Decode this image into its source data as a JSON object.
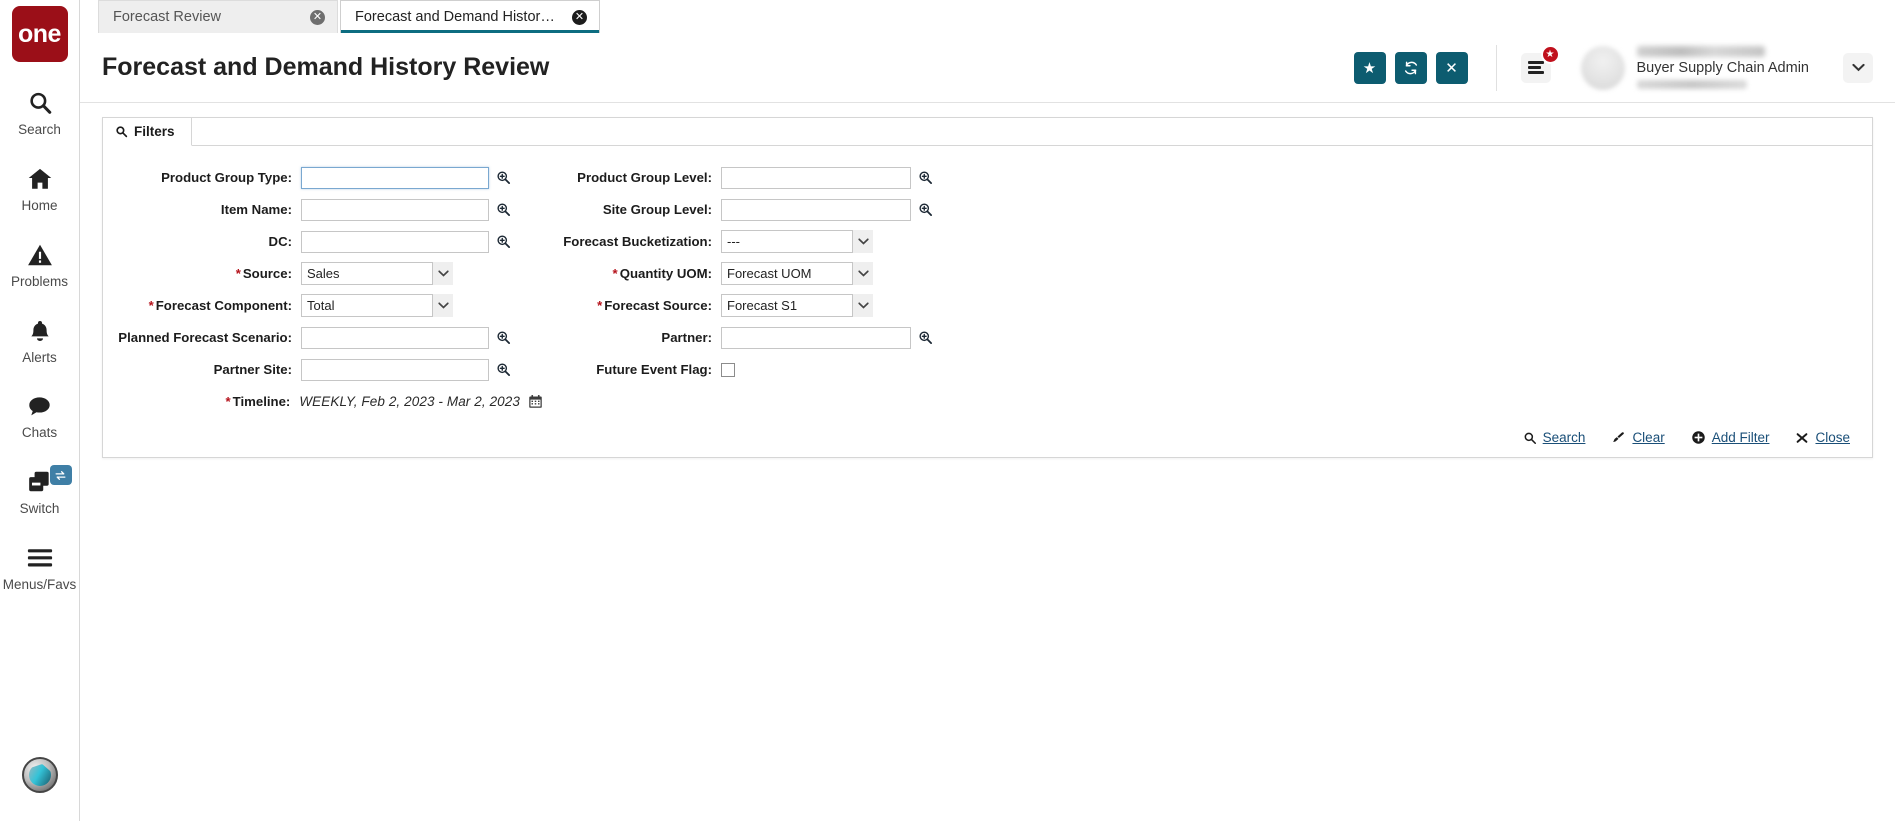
{
  "brand": {
    "logo_text": "one"
  },
  "sidebar": {
    "items": [
      {
        "label": "Search",
        "icon": "search-icon"
      },
      {
        "label": "Home",
        "icon": "home-icon"
      },
      {
        "label": "Problems",
        "icon": "warning-triangle-icon"
      },
      {
        "label": "Alerts",
        "icon": "bell-icon"
      },
      {
        "label": "Chats",
        "icon": "chat-bubble-icon"
      },
      {
        "label": "Switch",
        "icon": "switch-windows-icon",
        "badge_icon": "transfer-arrows-icon"
      },
      {
        "label": "Menus/Favs",
        "icon": "hamburger-icon"
      }
    ],
    "assistant_icon": "assistant-avatar-icon"
  },
  "tabs": [
    {
      "label": "Forecast Review",
      "active": false,
      "close_label": "✕"
    },
    {
      "label": "Forecast and Demand History Re...",
      "active": true,
      "close_label": "✕"
    }
  ],
  "header": {
    "title": "Forecast and Demand History Review",
    "actions": [
      {
        "name": "favorite-button",
        "icon": "star-icon",
        "glyph": "★"
      },
      {
        "name": "refresh-button",
        "icon": "refresh-icon",
        "glyph": "↻"
      },
      {
        "name": "close-button",
        "icon": "close-icon",
        "glyph": "✕"
      }
    ],
    "menu_badge_glyph": "★",
    "user_role": "Buyer Supply Chain Admin",
    "caret_glyph": "⌄"
  },
  "panel": {
    "tab_label": "Filters",
    "tab_icon": "search-icon"
  },
  "filters": {
    "left": [
      {
        "label": "Product Group Type:",
        "required": false,
        "type": "lookup",
        "value": "",
        "focused": true
      },
      {
        "label": "Item Name:",
        "required": false,
        "type": "lookup",
        "value": ""
      },
      {
        "label": "DC:",
        "required": false,
        "type": "lookup",
        "value": ""
      },
      {
        "label": "Source:",
        "required": true,
        "type": "select",
        "value": "Sales"
      },
      {
        "label": "Forecast Component:",
        "required": true,
        "type": "select",
        "value": "Total"
      },
      {
        "label": "Planned Forecast Scenario:",
        "required": false,
        "type": "lookup",
        "value": ""
      },
      {
        "label": "Partner Site:",
        "required": false,
        "type": "lookup",
        "value": ""
      },
      {
        "label": "Timeline:",
        "required": true,
        "type": "timeline",
        "value": "WEEKLY, Feb 2, 2023 - Mar 2, 2023"
      }
    ],
    "right": [
      {
        "label": "Product Group Level:",
        "required": false,
        "type": "lookup",
        "value": ""
      },
      {
        "label": "Site Group Level:",
        "required": false,
        "type": "lookup",
        "value": ""
      },
      {
        "label": "Forecast Bucketization:",
        "required": false,
        "type": "select",
        "value": "---"
      },
      {
        "label": "Quantity UOM:",
        "required": true,
        "type": "select",
        "value": "Forecast UOM"
      },
      {
        "label": "Forecast Source:",
        "required": true,
        "type": "select",
        "value": "Forecast S1"
      },
      {
        "label": "Partner:",
        "required": false,
        "type": "lookup",
        "value": ""
      },
      {
        "label": "Future Event Flag:",
        "required": false,
        "type": "checkbox",
        "checked": false
      }
    ]
  },
  "footer_links": [
    {
      "label": "Search",
      "icon": "search-icon"
    },
    {
      "label": "Clear",
      "icon": "brush-icon"
    },
    {
      "label": "Add Filter",
      "icon": "plus-circle-icon"
    },
    {
      "label": "Close",
      "icon": "close-x-icon"
    }
  ],
  "colors": {
    "brand_red": "#9b0f18",
    "accent_teal": "#0d5c70",
    "link_blue": "#1a4f78",
    "required_red": "#b5121b",
    "badge_red": "#c0111d"
  }
}
